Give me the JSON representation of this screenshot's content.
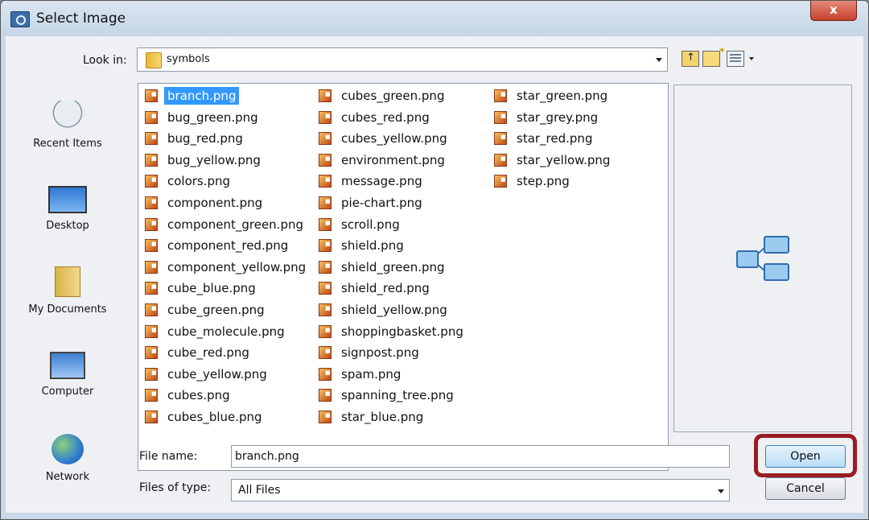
{
  "window": {
    "title": "Select Image",
    "close_label": "x"
  },
  "toolbar": {
    "lookin_label": "Look in:",
    "lookin_value": "symbols"
  },
  "places": [
    "Recent Items",
    "Desktop",
    "My Documents",
    "Computer",
    "Network"
  ],
  "files": {
    "column1": [
      "branch.png",
      "bug_green.png",
      "bug_red.png",
      "bug_yellow.png",
      "colors.png",
      "component.png",
      "component_green.png",
      "component_red.png",
      "component_yellow.png",
      "cube_blue.png",
      "cube_green.png",
      "cube_molecule.png",
      "cube_red.png",
      "cube_yellow.png",
      "cubes.png",
      "cubes_blue.png"
    ],
    "column2": [
      "cubes_green.png",
      "cubes_red.png",
      "cubes_yellow.png",
      "environment.png",
      "message.png",
      "pie-chart.png",
      "scroll.png",
      "shield.png",
      "shield_green.png",
      "shield_red.png",
      "shield_yellow.png",
      "shoppingbasket.png",
      "signpost.png",
      "spam.png",
      "spanning_tree.png",
      "star_blue.png"
    ],
    "column3": [
      "star_green.png",
      "star_grey.png",
      "star_red.png",
      "star_yellow.png",
      "step.png"
    ],
    "selected": "branch.png"
  },
  "form": {
    "filename_label": "File name:",
    "filename_value": "branch.png",
    "filetype_label": "Files of type:",
    "filetype_value": "All Files"
  },
  "buttons": {
    "open": "Open",
    "cancel": "Cancel"
  },
  "colors": {
    "selection": "#3399ff",
    "highlight": "#9b1b24"
  }
}
